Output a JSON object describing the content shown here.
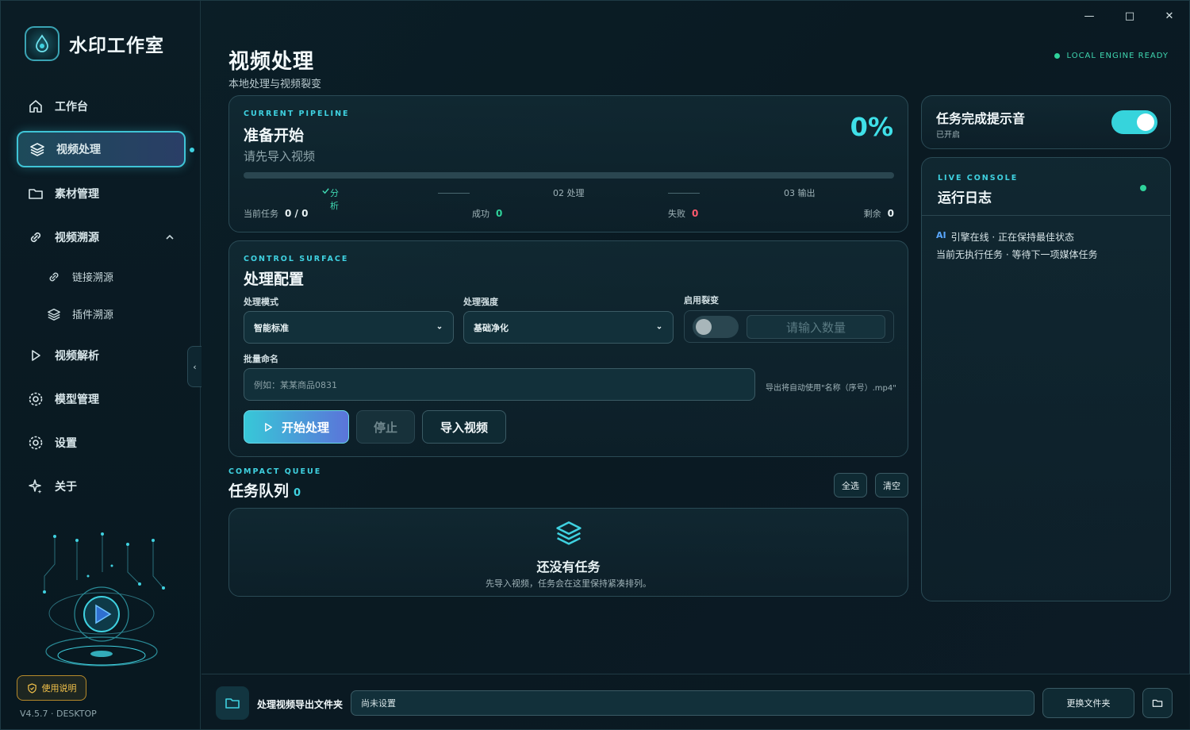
{
  "window": {
    "minimize": "—",
    "maximize": "□",
    "close": "✕"
  },
  "brand": {
    "title": "水印工作室",
    "logo_icon": "water-drop-icon"
  },
  "sidebar": {
    "items": [
      {
        "label": "工作台",
        "icon": "home-icon"
      },
      {
        "label": "视频处理",
        "icon": "layers-icon",
        "active": true
      },
      {
        "label": "素材管理",
        "icon": "folder-icon"
      },
      {
        "label": "视频溯源",
        "icon": "link-icon",
        "expanded": true
      },
      {
        "label": "链接溯源",
        "icon": "link-icon"
      },
      {
        "label": "插件溯源",
        "icon": "layers-icon"
      },
      {
        "label": "视频解析",
        "icon": "play-icon"
      },
      {
        "label": "模型管理",
        "icon": "gear-icon"
      },
      {
        "label": "设置",
        "icon": "gear-icon"
      },
      {
        "label": "关于",
        "icon": "sparkle-icon"
      }
    ],
    "collapse_label": "‹",
    "help_label": "使用说明",
    "version": "V4.5.7 · DESKTOP"
  },
  "header": {
    "title": "视频处理",
    "subtitle": "本地处理与视频裂变",
    "engine_status": "LOCAL ENGINE READY"
  },
  "pipeline": {
    "eyebrow": "CURRENT PIPELINE",
    "title": "准备开始",
    "subtitle": "请先导入视频",
    "percent": "0%",
    "progress": 0,
    "steps": [
      {
        "label": "分析",
        "done": true
      },
      {
        "label": "02 处理",
        "done": false
      },
      {
        "label": "03 输出",
        "done": false
      }
    ],
    "stats": {
      "current_label": "当前任务",
      "current_value": "0 / 0",
      "success_label": "成功",
      "success_value": "0",
      "fail_label": "失败",
      "fail_value": "0",
      "remain_label": "剩余",
      "remain_value": "0"
    }
  },
  "control": {
    "eyebrow": "CONTROL SURFACE",
    "title": "处理配置",
    "mode_label": "处理模式",
    "mode_value": "智能标准",
    "strength_label": "处理强度",
    "strength_value": "基础净化",
    "split_label": "启用裂变",
    "split_enabled": false,
    "count_placeholder": "请输入数量",
    "batch_label": "批量命名",
    "batch_placeholder": "例如：某某商品0831",
    "batch_hint": "导出将自动使用\"名称（序号）.mp4\"",
    "start_label": "开始处理",
    "stop_label": "停止",
    "import_label": "导入视频"
  },
  "queue": {
    "eyebrow": "COMPACT QUEUE",
    "title": "任务队列",
    "count": "0",
    "select_all": "全选",
    "clear": "清空",
    "empty_title": "还没有任务",
    "empty_sub": "先导入视频，任务会在这里保持紧凑排列。"
  },
  "sound": {
    "title": "任务完成提示音",
    "status": "已开启",
    "enabled": true
  },
  "console": {
    "eyebrow": "LIVE CONSOLE",
    "title": "运行日志",
    "lines": [
      {
        "tag": "AI",
        "text": "引擎在线 · 正在保持最佳状态"
      },
      {
        "tag": "",
        "text": "当前无执行任务 · 等待下一项媒体任务"
      }
    ]
  },
  "output": {
    "label": "处理视频导出文件夹",
    "path": "尚未设置",
    "change_label": "更换文件夹"
  },
  "colors": {
    "accent": "#3fd1e0",
    "success": "#2fd39b",
    "danger": "#ff5a6e",
    "warning": "#f3c24a"
  }
}
